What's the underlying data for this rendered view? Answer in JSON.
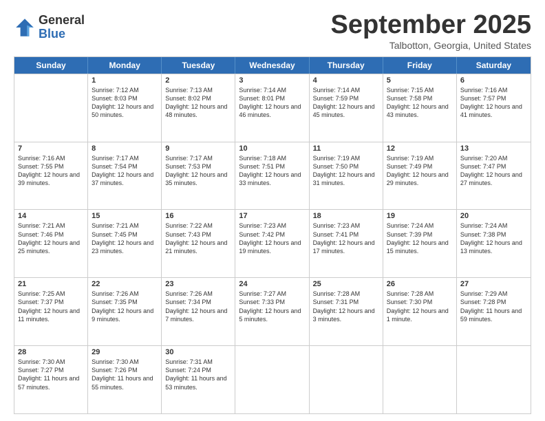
{
  "logo": {
    "general": "General",
    "blue": "Blue"
  },
  "title": "September 2025",
  "subtitle": "Talbotton, Georgia, United States",
  "days": [
    "Sunday",
    "Monday",
    "Tuesday",
    "Wednesday",
    "Thursday",
    "Friday",
    "Saturday"
  ],
  "weeks": [
    [
      {
        "day": "",
        "sunrise": "",
        "sunset": "",
        "daylight": ""
      },
      {
        "day": "1",
        "sunrise": "Sunrise: 7:12 AM",
        "sunset": "Sunset: 8:03 PM",
        "daylight": "Daylight: 12 hours and 50 minutes."
      },
      {
        "day": "2",
        "sunrise": "Sunrise: 7:13 AM",
        "sunset": "Sunset: 8:02 PM",
        "daylight": "Daylight: 12 hours and 48 minutes."
      },
      {
        "day": "3",
        "sunrise": "Sunrise: 7:14 AM",
        "sunset": "Sunset: 8:01 PM",
        "daylight": "Daylight: 12 hours and 46 minutes."
      },
      {
        "day": "4",
        "sunrise": "Sunrise: 7:14 AM",
        "sunset": "Sunset: 7:59 PM",
        "daylight": "Daylight: 12 hours and 45 minutes."
      },
      {
        "day": "5",
        "sunrise": "Sunrise: 7:15 AM",
        "sunset": "Sunset: 7:58 PM",
        "daylight": "Daylight: 12 hours and 43 minutes."
      },
      {
        "day": "6",
        "sunrise": "Sunrise: 7:16 AM",
        "sunset": "Sunset: 7:57 PM",
        "daylight": "Daylight: 12 hours and 41 minutes."
      }
    ],
    [
      {
        "day": "7",
        "sunrise": "Sunrise: 7:16 AM",
        "sunset": "Sunset: 7:55 PM",
        "daylight": "Daylight: 12 hours and 39 minutes."
      },
      {
        "day": "8",
        "sunrise": "Sunrise: 7:17 AM",
        "sunset": "Sunset: 7:54 PM",
        "daylight": "Daylight: 12 hours and 37 minutes."
      },
      {
        "day": "9",
        "sunrise": "Sunrise: 7:17 AM",
        "sunset": "Sunset: 7:53 PM",
        "daylight": "Daylight: 12 hours and 35 minutes."
      },
      {
        "day": "10",
        "sunrise": "Sunrise: 7:18 AM",
        "sunset": "Sunset: 7:51 PM",
        "daylight": "Daylight: 12 hours and 33 minutes."
      },
      {
        "day": "11",
        "sunrise": "Sunrise: 7:19 AM",
        "sunset": "Sunset: 7:50 PM",
        "daylight": "Daylight: 12 hours and 31 minutes."
      },
      {
        "day": "12",
        "sunrise": "Sunrise: 7:19 AM",
        "sunset": "Sunset: 7:49 PM",
        "daylight": "Daylight: 12 hours and 29 minutes."
      },
      {
        "day": "13",
        "sunrise": "Sunrise: 7:20 AM",
        "sunset": "Sunset: 7:47 PM",
        "daylight": "Daylight: 12 hours and 27 minutes."
      }
    ],
    [
      {
        "day": "14",
        "sunrise": "Sunrise: 7:21 AM",
        "sunset": "Sunset: 7:46 PM",
        "daylight": "Daylight: 12 hours and 25 minutes."
      },
      {
        "day": "15",
        "sunrise": "Sunrise: 7:21 AM",
        "sunset": "Sunset: 7:45 PM",
        "daylight": "Daylight: 12 hours and 23 minutes."
      },
      {
        "day": "16",
        "sunrise": "Sunrise: 7:22 AM",
        "sunset": "Sunset: 7:43 PM",
        "daylight": "Daylight: 12 hours and 21 minutes."
      },
      {
        "day": "17",
        "sunrise": "Sunrise: 7:23 AM",
        "sunset": "Sunset: 7:42 PM",
        "daylight": "Daylight: 12 hours and 19 minutes."
      },
      {
        "day": "18",
        "sunrise": "Sunrise: 7:23 AM",
        "sunset": "Sunset: 7:41 PM",
        "daylight": "Daylight: 12 hours and 17 minutes."
      },
      {
        "day": "19",
        "sunrise": "Sunrise: 7:24 AM",
        "sunset": "Sunset: 7:39 PM",
        "daylight": "Daylight: 12 hours and 15 minutes."
      },
      {
        "day": "20",
        "sunrise": "Sunrise: 7:24 AM",
        "sunset": "Sunset: 7:38 PM",
        "daylight": "Daylight: 12 hours and 13 minutes."
      }
    ],
    [
      {
        "day": "21",
        "sunrise": "Sunrise: 7:25 AM",
        "sunset": "Sunset: 7:37 PM",
        "daylight": "Daylight: 12 hours and 11 minutes."
      },
      {
        "day": "22",
        "sunrise": "Sunrise: 7:26 AM",
        "sunset": "Sunset: 7:35 PM",
        "daylight": "Daylight: 12 hours and 9 minutes."
      },
      {
        "day": "23",
        "sunrise": "Sunrise: 7:26 AM",
        "sunset": "Sunset: 7:34 PM",
        "daylight": "Daylight: 12 hours and 7 minutes."
      },
      {
        "day": "24",
        "sunrise": "Sunrise: 7:27 AM",
        "sunset": "Sunset: 7:33 PM",
        "daylight": "Daylight: 12 hours and 5 minutes."
      },
      {
        "day": "25",
        "sunrise": "Sunrise: 7:28 AM",
        "sunset": "Sunset: 7:31 PM",
        "daylight": "Daylight: 12 hours and 3 minutes."
      },
      {
        "day": "26",
        "sunrise": "Sunrise: 7:28 AM",
        "sunset": "Sunset: 7:30 PM",
        "daylight": "Daylight: 12 hours and 1 minute."
      },
      {
        "day": "27",
        "sunrise": "Sunrise: 7:29 AM",
        "sunset": "Sunset: 7:28 PM",
        "daylight": "Daylight: 11 hours and 59 minutes."
      }
    ],
    [
      {
        "day": "28",
        "sunrise": "Sunrise: 7:30 AM",
        "sunset": "Sunset: 7:27 PM",
        "daylight": "Daylight: 11 hours and 57 minutes."
      },
      {
        "day": "29",
        "sunrise": "Sunrise: 7:30 AM",
        "sunset": "Sunset: 7:26 PM",
        "daylight": "Daylight: 11 hours and 55 minutes."
      },
      {
        "day": "30",
        "sunrise": "Sunrise: 7:31 AM",
        "sunset": "Sunset: 7:24 PM",
        "daylight": "Daylight: 11 hours and 53 minutes."
      },
      {
        "day": "",
        "sunrise": "",
        "sunset": "",
        "daylight": ""
      },
      {
        "day": "",
        "sunrise": "",
        "sunset": "",
        "daylight": ""
      },
      {
        "day": "",
        "sunrise": "",
        "sunset": "",
        "daylight": ""
      },
      {
        "day": "",
        "sunrise": "",
        "sunset": "",
        "daylight": ""
      }
    ]
  ]
}
